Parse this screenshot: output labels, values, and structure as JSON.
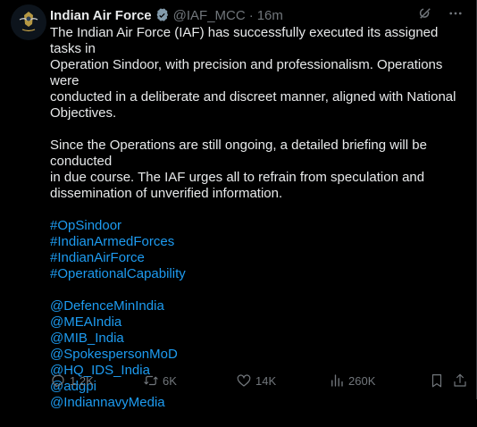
{
  "tweet": {
    "name": "Indian Air Force",
    "handle": "@IAF_MCC",
    "separator": "·",
    "time": "16m",
    "body_lines_1": [
      "The Indian Air Force (IAF) has successfully executed its assigned tasks in",
      "Operation Sindoor, with precision and professionalism. Operations were",
      "conducted in a deliberate and discreet manner, aligned with National",
      "Objectives."
    ],
    "body_lines_2": [
      "Since the Operations are still ongoing, a detailed briefing will be conducted",
      "in due course. The IAF urges all to refrain from speculation and",
      "dissemination of unverified information."
    ],
    "hashtags": [
      "#OpSindoor",
      "#IndianArmedForces",
      "#IndianAirForce",
      "#OperationalCapability"
    ],
    "mentions": [
      "@DefenceMinIndia",
      "@MEAIndia",
      "@MIB_India",
      "@SpokespersonMoD",
      "@HQ_IDS_India",
      "@adgpi",
      "@IndiannavyMedia"
    ]
  },
  "actions": {
    "replies": "1.2K",
    "reposts": "6K",
    "likes": "14K",
    "views": "260K"
  },
  "icons": {
    "verified": "verified-badge-icon",
    "grok": "grok-icon",
    "more": "more-icon",
    "reply": "reply-icon",
    "repost": "repost-icon",
    "like": "like-icon",
    "views": "views-icon",
    "bookmark": "bookmark-icon",
    "share": "share-icon"
  },
  "colors": {
    "background": "#000000",
    "text": "#e7e9ea",
    "muted": "#71767b",
    "link": "#1d9bf0",
    "verified": "#829aab"
  }
}
